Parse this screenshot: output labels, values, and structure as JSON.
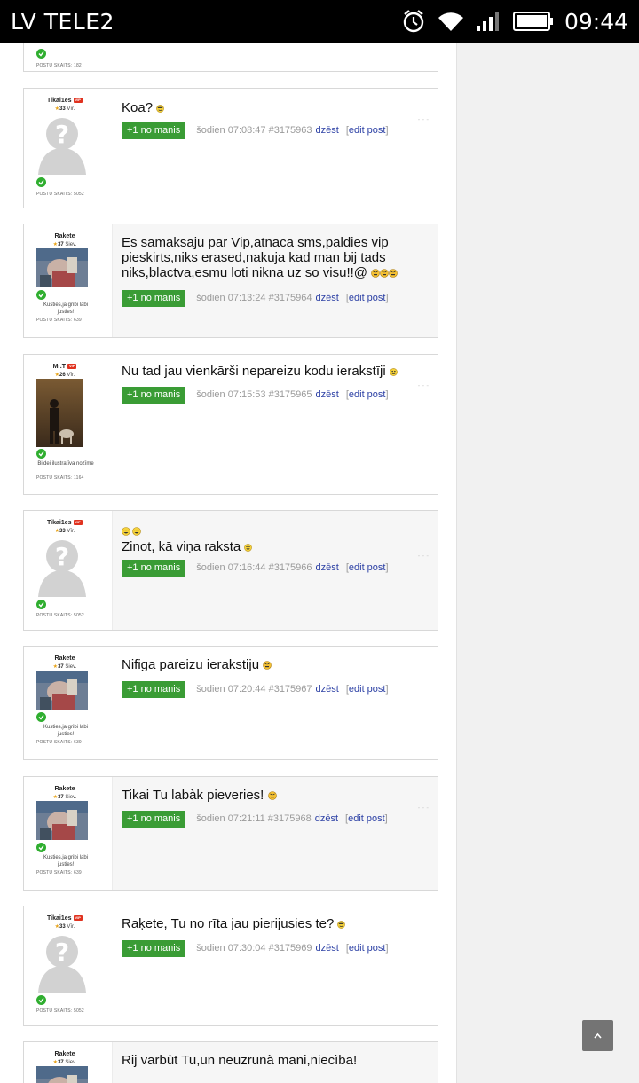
{
  "status_bar": {
    "carrier": "LV TELE2",
    "time": "09:44",
    "icons": [
      "alarm-icon",
      "wifi-icon",
      "signal-icon",
      "battery-icon"
    ]
  },
  "top_partial": {
    "post_count": "POSTU SKAITS: 182"
  },
  "posts": [
    {
      "user": "Tikai1es",
      "vip": "VIP",
      "age_num": "33",
      "age_unit": "Vīr.",
      "post_count": "POSTU SKAITS: 5052",
      "signature": "",
      "text": "Koa?",
      "plus_label": "+1 no manis",
      "date": "šodien 07:08:47 #3175963",
      "delete": "dzēst",
      "edit": "edit post"
    },
    {
      "user": "Rakete",
      "vip": "",
      "age_num": "37",
      "age_unit": "Siev.",
      "post_count": "POSTU SKAITS: 639",
      "signature": "Kusties,ja gribi labi justies!",
      "text": "Es samaksaju par Vip,atnaca sms,paldies vip pieskirts,niks erased,nakuja kad man bij tads niks,blactva,esmu loti nikna uz so visu!!@",
      "plus_label": "+1 no manis",
      "date": "šodien 07:13:24 #3175964",
      "delete": "dzēst",
      "edit": "edit post"
    },
    {
      "user": "Mr.T",
      "vip": "VIP",
      "age_num": "26",
      "age_unit": "Vīr.",
      "post_count": "POSTU SKAITS: 1164",
      "signature": "Bildei ilustratīva nozīme",
      "text": "Nu tad jau vienkārši nepareizu kodu ierakstīji",
      "plus_label": "+1 no manis",
      "date": "šodien 07:15:53 #3175965",
      "delete": "dzēst",
      "edit": "edit post"
    },
    {
      "user": "Tikai1es",
      "vip": "VIP",
      "age_num": "33",
      "age_unit": "Vīr.",
      "post_count": "POSTU SKAITS: 5052",
      "signature": "",
      "text": "Zinot, kā viņa raksta",
      "plus_label": "+1 no manis",
      "date": "šodien 07:16:44 #3175966",
      "delete": "dzēst",
      "edit": "edit post"
    },
    {
      "user": "Rakete",
      "vip": "",
      "age_num": "37",
      "age_unit": "Siev.",
      "post_count": "POSTU SKAITS: 639",
      "signature": "Kusties,ja gribi labi justies!",
      "text": "Nifiga pareizu ierakstiju",
      "plus_label": "+1 no manis",
      "date": "šodien 07:20:44 #3175967",
      "delete": "dzēst",
      "edit": "edit post"
    },
    {
      "user": "Rakete",
      "vip": "",
      "age_num": "37",
      "age_unit": "Siev.",
      "post_count": "POSTU SKAITS: 639",
      "signature": "Kusties,ja gribi labi justies!",
      "text": "Tikai Tu labàk pieveries!",
      "plus_label": "+1 no manis",
      "date": "šodien 07:21:11 #3175968",
      "delete": "dzēst",
      "edit": "edit post"
    },
    {
      "user": "Tikai1es",
      "vip": "VIP",
      "age_num": "33",
      "age_unit": "Vīr.",
      "post_count": "POSTU SKAITS: 5052",
      "signature": "",
      "text": "Raķete, Tu no rīta jau pierijusies te?",
      "plus_label": "+1 no manis",
      "date": "šodien 07:30:04 #3175969",
      "delete": "dzēst",
      "edit": "edit post"
    },
    {
      "user": "Rakete",
      "vip": "",
      "age_num": "37",
      "age_unit": "Siev.",
      "text": "Rij varbùt Tu,un neuzrunà mani,niecìba!"
    }
  ]
}
